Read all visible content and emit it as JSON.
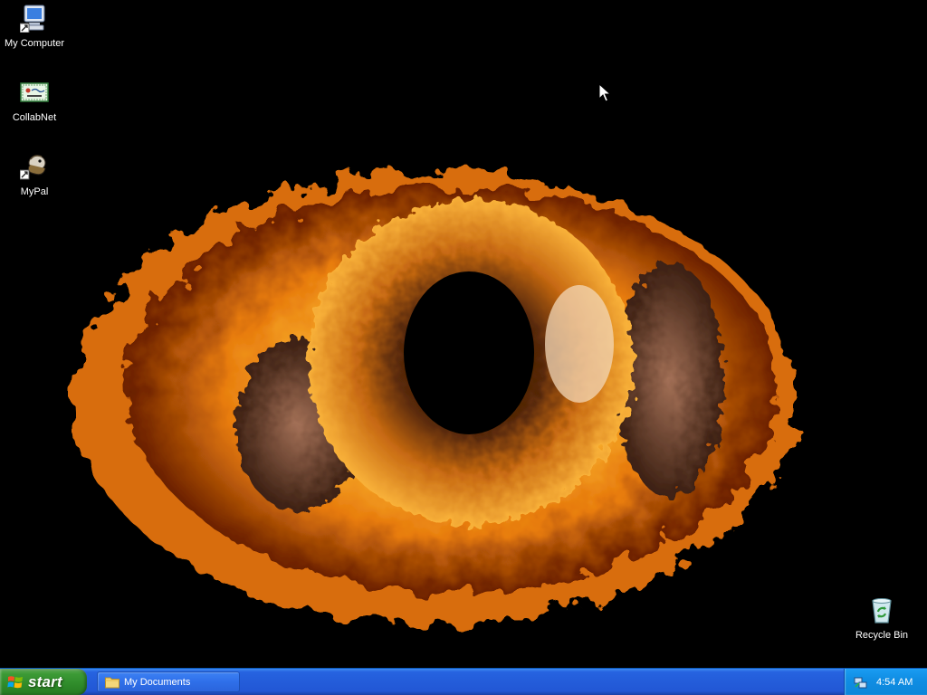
{
  "desktop": {
    "icons": [
      {
        "label": "My Computer",
        "icon": "my-computer-icon"
      },
      {
        "label": "CollabNet",
        "icon": "collabnet-icon"
      },
      {
        "label": "MyPal",
        "icon": "mypal-icon"
      },
      {
        "label": "Recycle Bin",
        "icon": "recycle-bin-icon"
      }
    ],
    "wallpaper": "flaming-eye",
    "colors": {
      "background": "#000000",
      "flame": "#f7a21c",
      "pupil": "#000000"
    }
  },
  "taskbar": {
    "start_label": "start",
    "tasks": [
      {
        "label": "My Documents",
        "icon": "folder-icon"
      }
    ],
    "tray": {
      "icon": "network-icon",
      "clock": "4:54 AM"
    },
    "colors": {
      "bar": "#245edb",
      "start": "#3c9a36",
      "tray": "#108ee4"
    }
  }
}
